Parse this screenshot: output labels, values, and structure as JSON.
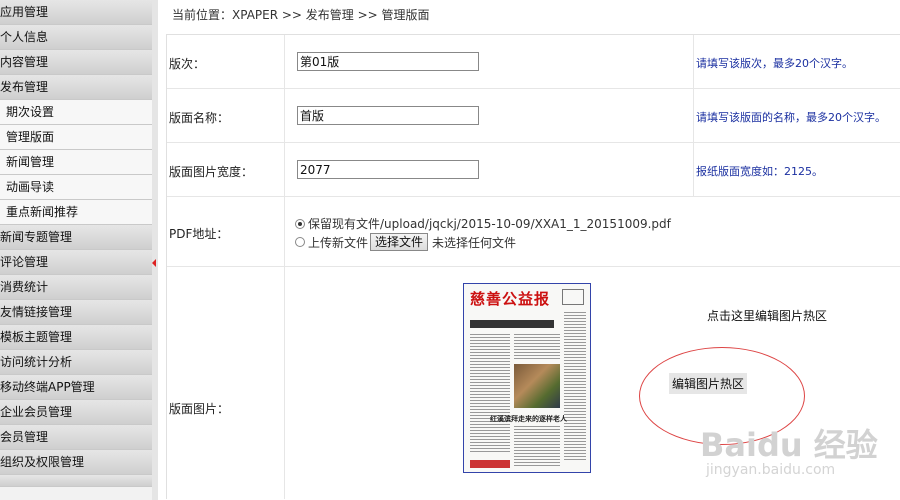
{
  "sidebar": {
    "items": [
      {
        "label": "应用管理",
        "type": "cat"
      },
      {
        "label": "个人信息",
        "type": "cat"
      },
      {
        "label": "内容管理",
        "type": "cat"
      },
      {
        "label": "发布管理",
        "type": "cat"
      },
      {
        "label": "期次设置",
        "type": "sub"
      },
      {
        "label": "管理版面",
        "type": "sub"
      },
      {
        "label": "新闻管理",
        "type": "sub"
      },
      {
        "label": "动画导读",
        "type": "sub"
      },
      {
        "label": "重点新闻推荐",
        "type": "sub"
      },
      {
        "label": "新闻专题管理",
        "type": "cat"
      },
      {
        "label": "评论管理",
        "type": "cat"
      },
      {
        "label": "消费统计",
        "type": "cat"
      },
      {
        "label": "友情链接管理",
        "type": "cat"
      },
      {
        "label": "模板主题管理",
        "type": "cat"
      },
      {
        "label": "访问统计分析",
        "type": "cat"
      },
      {
        "label": "移动终端APP管理",
        "type": "cat"
      },
      {
        "label": "企业会员管理",
        "type": "cat"
      },
      {
        "label": "会员管理",
        "type": "cat"
      },
      {
        "label": "组织及权限管理",
        "type": "cat"
      }
    ]
  },
  "breadcrumb": "当前位置：XPAPER >> 发布管理 >> 管理版面",
  "form": {
    "edition": {
      "label": "版次：",
      "value": "第01版",
      "hint": "请填写该版次，最多20个汉字。"
    },
    "page_name": {
      "label": "版面名称：",
      "value": "首版",
      "hint": "请填写该版面的名称，最多20个汉字。"
    },
    "image_width": {
      "label": "版面图片宽度：",
      "value": "2077",
      "hint": "报纸版面宽度如：2125。"
    },
    "pdf": {
      "label": "PDF地址：",
      "keep_option": "保留现有文件/upload/jqckj/2015-10-09/XXA1_1_20151009.pdf",
      "upload_option": "上传新文件",
      "choose_button": "选择文件",
      "no_file_text": "未选择任何文件"
    },
    "page_image": {
      "label": "版面图片：",
      "hotspot_link": "点击这里编辑图片热区",
      "hotspot_button": "编辑图片热区",
      "thumbnail": {
        "masthead": "慈善公益报",
        "bottom_headline": "红溪滨拜走来的逐样老人"
      }
    }
  },
  "watermark": {
    "brand": "Baidu 经验",
    "url": "jingyan.baidu.com"
  },
  "colors": {
    "hint_text": "#1a2fa0",
    "ellipse": "#d44444",
    "masthead": "#cc1111"
  }
}
